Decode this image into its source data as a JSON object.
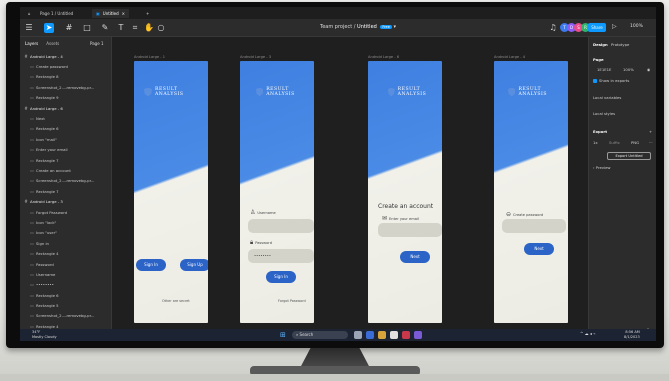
{
  "window": {
    "tabs": [
      {
        "label": "Page 1 / Untitled"
      },
      {
        "label": "Untitled"
      }
    ],
    "tab_add": "+"
  },
  "toolbar": {
    "project": "Team project",
    "file_name": "Untitled",
    "plan_badge": "Free",
    "share_label": "Share",
    "zoom": "100%",
    "avatars": [
      {
        "letter": "T",
        "color": "#3c7cf0"
      },
      {
        "letter": "D",
        "color": "#8d5cf6"
      },
      {
        "letter": "S",
        "color": "#e84d8a"
      },
      {
        "letter": "R",
        "color": "#2fb26a"
      }
    ]
  },
  "left_panel": {
    "tabs": [
      "Layers",
      "Assets"
    ],
    "page": "Page 1",
    "layers": [
      {
        "label": "Android Large - 4",
        "frame": true
      },
      {
        "label": "Create password",
        "frame": false
      },
      {
        "label": "Rectangle 8",
        "frame": false
      },
      {
        "label": "Screenshot_2...-removebg-pr...",
        "frame": false
      },
      {
        "label": "Rectangle 9",
        "frame": false
      },
      {
        "label": "Android Large - 6",
        "frame": true
      },
      {
        "label": "Next",
        "frame": false
      },
      {
        "label": "Rectangle 6",
        "frame": false
      },
      {
        "label": "Icon \"mail\"",
        "frame": false
      },
      {
        "label": "Enter your email",
        "frame": false
      },
      {
        "label": "Rectangle 7",
        "frame": false
      },
      {
        "label": "Create an account",
        "frame": false
      },
      {
        "label": "Screenshot_2...-removebg-pr...",
        "frame": false
      },
      {
        "label": "Rectangle 7",
        "frame": false
      },
      {
        "label": "Android Large - 3",
        "frame": true
      },
      {
        "label": "Forgot Password",
        "frame": false
      },
      {
        "label": "Icon \"lock\"",
        "frame": false
      },
      {
        "label": "Icon \"user\"",
        "frame": false
      },
      {
        "label": "Sign in",
        "frame": false
      },
      {
        "label": "Rectangle 4",
        "frame": false
      },
      {
        "label": "Password",
        "frame": false
      },
      {
        "label": "Username",
        "frame": false
      },
      {
        "label": "••••••••",
        "frame": false
      },
      {
        "label": "Rectangle 6",
        "frame": false
      },
      {
        "label": "Rectangle 5",
        "frame": false
      },
      {
        "label": "Screenshot_2...-removebg-pr...",
        "frame": false
      },
      {
        "label": "Rectangle 4",
        "frame": false
      },
      {
        "label": "Android Large - 1",
        "frame": true
      }
    ]
  },
  "canvas": {
    "frames": [
      {
        "label": "Android Large - 1"
      },
      {
        "label": "Android Large - 3"
      },
      {
        "label": "Android Large - 6"
      },
      {
        "label": "Android Large - 4"
      }
    ],
    "brand": "RESULT ANALYSIS",
    "screen1": {
      "sign_in": "Sign In",
      "sign_up": "Sign Up",
      "footer": "Other are secret"
    },
    "screen2": {
      "username_label": "Username",
      "password_label": "Password",
      "password_value": "••••••••",
      "sign_in": "Sign In",
      "forgot": "Forgot Password"
    },
    "screen3": {
      "heading": "Create an account",
      "email_label": "Enter your email",
      "next": "Next"
    },
    "screen4": {
      "password_label": "Create password",
      "next": "Next"
    }
  },
  "right_panel": {
    "tabs": [
      "Design",
      "Prototype"
    ],
    "page_heading": "Page",
    "page_color": "1E1E1E",
    "page_opacity": "100%",
    "show_exports": "Show in exports",
    "local_variables": "Local variables",
    "local_styles": "Local styles",
    "export_heading": "Export",
    "export_scale": "1x",
    "export_suffix": "Suffix",
    "export_format": "PNG",
    "export_button": "Export Untitled",
    "preview": "Preview",
    "help": "?"
  },
  "taskbar": {
    "weather_temp": "34°F",
    "weather_desc": "Mostly Cloudy",
    "search_placeholder": "Search",
    "time": "8:56 AM",
    "date": "8/1/2023"
  }
}
